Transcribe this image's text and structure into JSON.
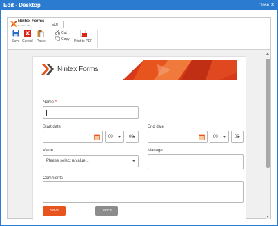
{
  "window": {
    "title": "Edit - Desktop",
    "close_label": "Close"
  },
  "ribbon": {
    "brand": {
      "name": "Nintex Forms",
      "sub": "for Office 365"
    },
    "tab": "EDIT",
    "buttons": {
      "save": "Save",
      "cancel": "Cancel",
      "paste": "Paste",
      "cut": "Cut",
      "copy": "Copy",
      "print": "Print to PDF"
    }
  },
  "form": {
    "banner_logo": "Nintex Forms",
    "name_label": "Name",
    "name_required": "*",
    "start_date_label": "Start date",
    "end_date_label": "End date",
    "start_hour": "00",
    "start_minute": "00",
    "end_hour": "00",
    "end_minute": "00",
    "value_label": "Value",
    "value_placeholder": "Please select a value...",
    "manager_label": "Manager",
    "comments_label": "Comments",
    "save_button": "Save",
    "cancel_button": "Cancel"
  },
  "colors": {
    "titlebar": "#2b7bd0",
    "accent": "#e8541e",
    "cancel": "#8c8c8c"
  }
}
